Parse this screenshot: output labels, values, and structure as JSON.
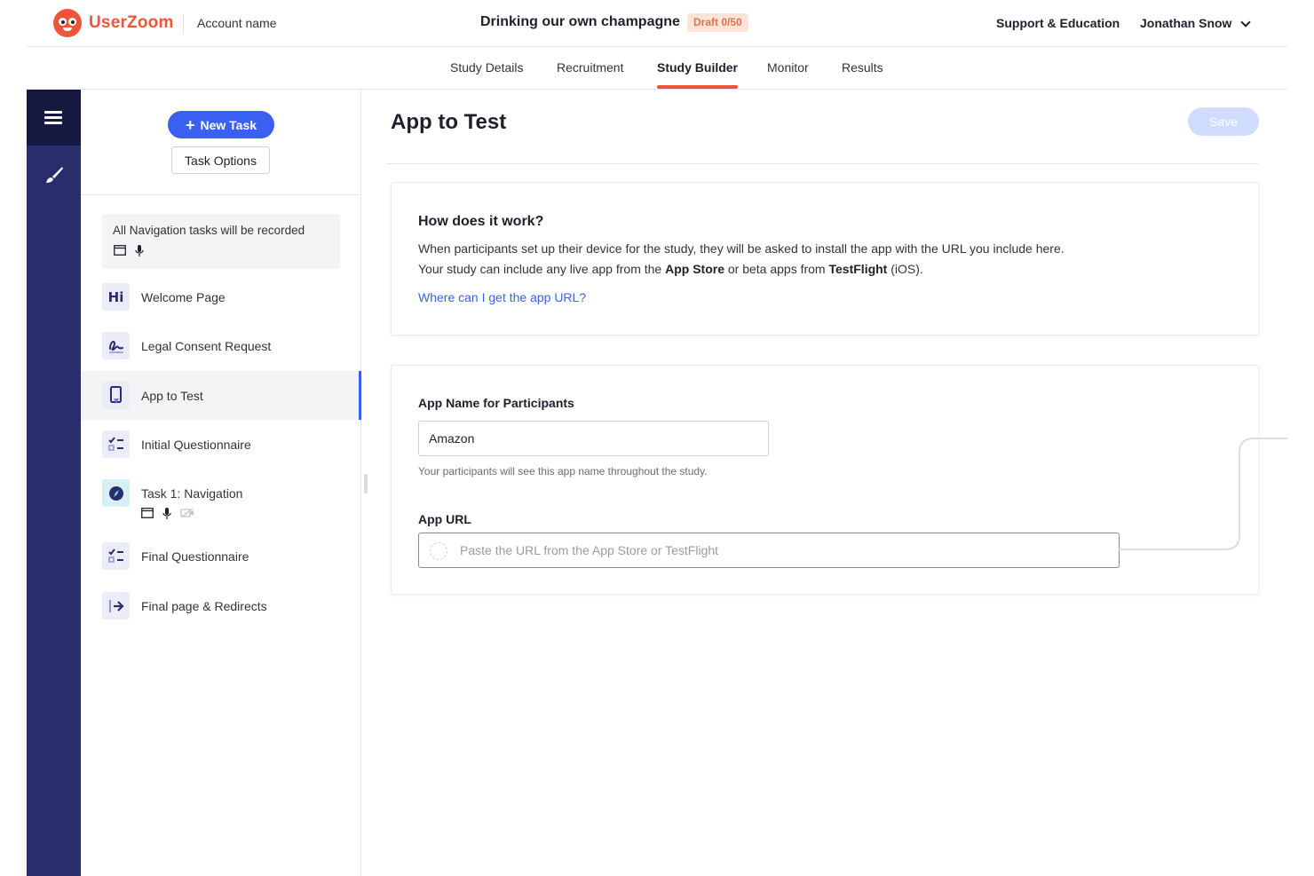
{
  "header": {
    "brand": "UserZoom",
    "account_name": "Account name",
    "study_title": "Drinking our own champagne",
    "draft_badge": "Draft 0/50",
    "support_link": "Support & Education",
    "user_name": "Jonathan Snow"
  },
  "tabs": [
    {
      "label": "Study Details",
      "active": false
    },
    {
      "label": "Recruitment",
      "active": false
    },
    {
      "label": "Study Builder",
      "active": true
    },
    {
      "label": "Monitor",
      "active": false
    },
    {
      "label": "Results",
      "active": false
    }
  ],
  "rail": {
    "items": [
      {
        "icon": "list-icon",
        "active": true
      },
      {
        "icon": "brush-icon",
        "active": false
      }
    ]
  },
  "task_panel": {
    "new_task_label": "New Task",
    "task_options_label": "Task Options",
    "nav_note": {
      "text": "All Navigation tasks will be recorded",
      "icons": [
        "screen-icon",
        "microphone-icon"
      ]
    },
    "tasks": [
      {
        "label": "Welcome Page",
        "icon": "hi-icon",
        "active": false
      },
      {
        "label": "Legal Consent Request",
        "icon": "signature-icon",
        "active": false
      },
      {
        "label": "App to Test",
        "icon": "phone-icon",
        "active": true
      },
      {
        "label": "Initial Questionnaire",
        "icon": "checklist-icon",
        "active": false
      },
      {
        "label": "Task 1: Navigation",
        "icon": "compass-icon",
        "active": false,
        "sub_icons": [
          "screen-icon",
          "microphone-icon",
          "camera-off-icon"
        ]
      },
      {
        "label": "Final Questionnaire",
        "icon": "checklist-icon",
        "active": false
      },
      {
        "label": "Final page & Redirects",
        "icon": "exit-arrow-icon",
        "active": false
      }
    ]
  },
  "main": {
    "title": "App to Test",
    "save_label": "Save",
    "info_card": {
      "heading": "How does it work?",
      "line1": "When participants set up their device for the study, they will be asked to install the app with the URL you include here.",
      "line2_prefix": "Your study can include any live app from the ",
      "line2_bold1": "App Store",
      "line2_mid": " or beta apps from ",
      "line2_bold2": "TestFlight",
      "line2_suffix": " (iOS).",
      "link": "Where can I get the app URL?"
    },
    "form": {
      "app_name_label": "App Name for Participants",
      "app_name_value": "Amazon",
      "app_name_helper": "Your participants will see this app name throughout the study.",
      "app_url_label": "App URL",
      "app_url_value": "",
      "app_url_placeholder": "Paste the URL from the App Store or TestFlight"
    }
  },
  "colors": {
    "brand": "#f0553c",
    "accent": "#3b5ff0",
    "rail": "#2a2d6b",
    "rail_active": "#15183f",
    "draft_badge_bg": "#fde4d9",
    "save_disabled": "#cfdcff"
  }
}
